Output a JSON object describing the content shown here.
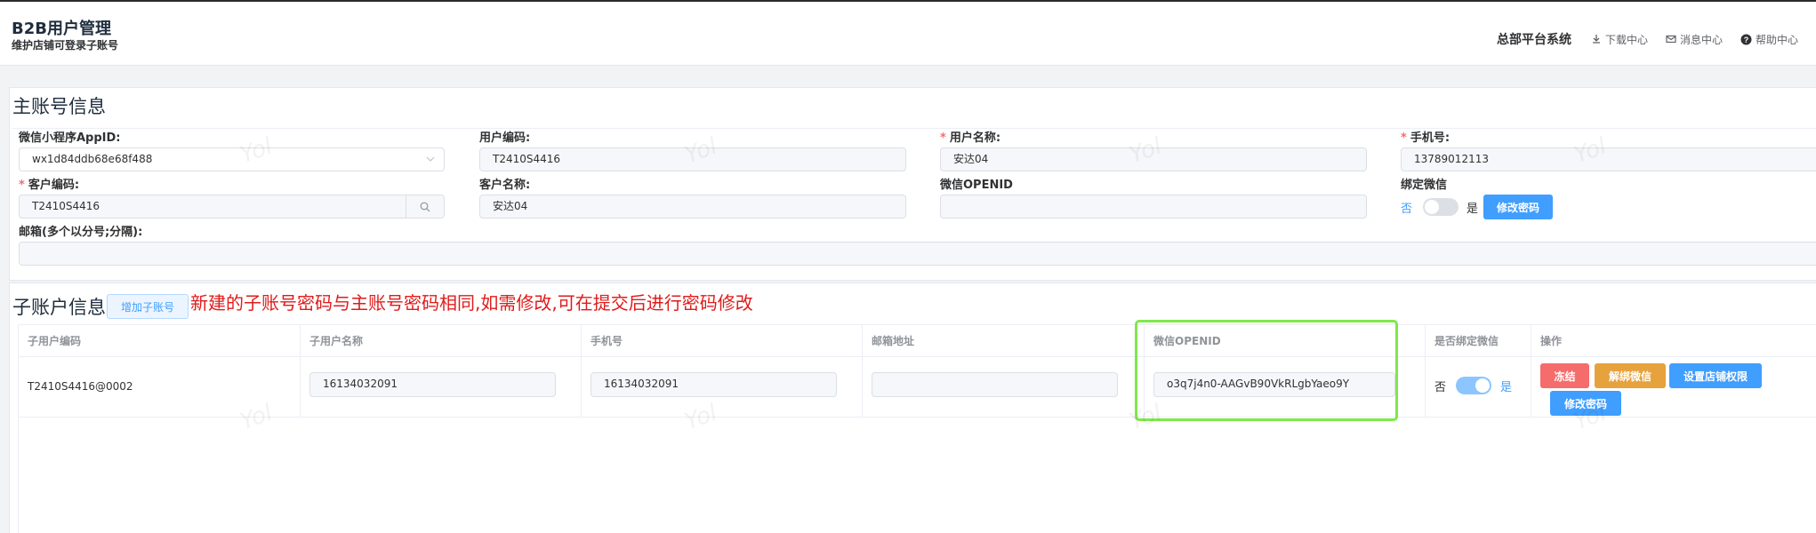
{
  "header": {
    "title": "B2B用户管理",
    "subtitle": "维护店铺可登录子账号",
    "system_name": "总部平台系统",
    "links": [
      {
        "label": "下载中心",
        "icon": "download-icon"
      },
      {
        "label": "消息中心",
        "icon": "mail-icon"
      },
      {
        "label": "帮助中心",
        "icon": "help-icon"
      }
    ]
  },
  "main_account": {
    "section_title": "主账号信息",
    "appid": {
      "label": "微信小程序AppID:",
      "value": "wx1d84ddb68e68f488"
    },
    "user_code": {
      "label": "用户编码:",
      "value": "T2410S4416"
    },
    "user_name": {
      "label": "用户名称:",
      "value": "安达04",
      "required": true
    },
    "phone": {
      "label": "手机号:",
      "value": "13789012113",
      "required": true
    },
    "customer_code": {
      "label": "客户编码:",
      "value": "T2410S4416",
      "required": true
    },
    "customer_name": {
      "label": "客户名称:",
      "value": "安达04"
    },
    "openid": {
      "label": "微信OPENID",
      "value": ""
    },
    "bind_wechat": {
      "label": "绑定微信",
      "no": "否",
      "yes": "是",
      "checked": false
    },
    "change_password": "修改密码",
    "email": {
      "label": "邮箱(多个以分号;分隔):",
      "value": ""
    }
  },
  "sub_account": {
    "section_title": "子账户信息",
    "add_button": "增加子账号",
    "note": "新建的子账号密码与主账号密码相同,如需修改,可在提交后进行密码修改",
    "columns": [
      "子用户编码",
      "子用户名称",
      "手机号",
      "邮箱地址",
      "微信OPENID",
      "是否绑定微信",
      "操作"
    ],
    "rows": [
      {
        "code": "T2410S4416@0002",
        "name": "16134032091",
        "phone": "16134032091",
        "email": "",
        "openid": "o3q7j4n0-AAGvB90VkRLgbYaeo9Y",
        "bind_no": "否",
        "bind_yes": "是",
        "bound": true,
        "actions": {
          "freeze": "冻结",
          "unbind": "解绑微信",
          "shop_permission": "设置店铺权限",
          "change_password": "修改密码"
        }
      }
    ]
  },
  "watermark": "Yol",
  "colors": {
    "primary": "#409eff",
    "danger": "#f56c6c",
    "warning": "#e6a23c",
    "highlight": "#7ee84a",
    "note": "#e01b1b"
  }
}
